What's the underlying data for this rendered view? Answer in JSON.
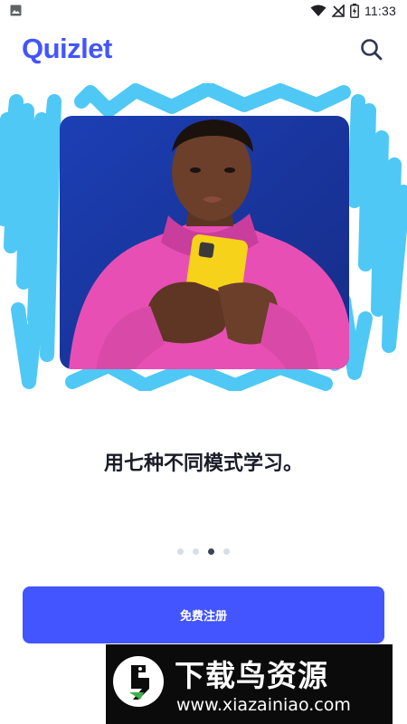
{
  "status_bar": {
    "time": "11:33",
    "icons": [
      "gallery-icon",
      "wifi-icon",
      "no-signal-icon",
      "battery-charging-icon"
    ]
  },
  "header": {
    "logo_text": "Quizlet",
    "search_icon": "search-icon"
  },
  "onboarding": {
    "headline": "用七种不同模式学习。",
    "page_count": 4,
    "active_page": 3
  },
  "cta": {
    "signup_label": "免费注册"
  },
  "watermark": {
    "title": "下载鸟资源",
    "url": "www.xiazainiao.com"
  },
  "colors": {
    "brand": "#4255ff",
    "scribble": "#4fc8f5",
    "hoodie": "#e84fb4",
    "photo_bg": "#1e3aa8",
    "phone": "#f7d21b"
  }
}
